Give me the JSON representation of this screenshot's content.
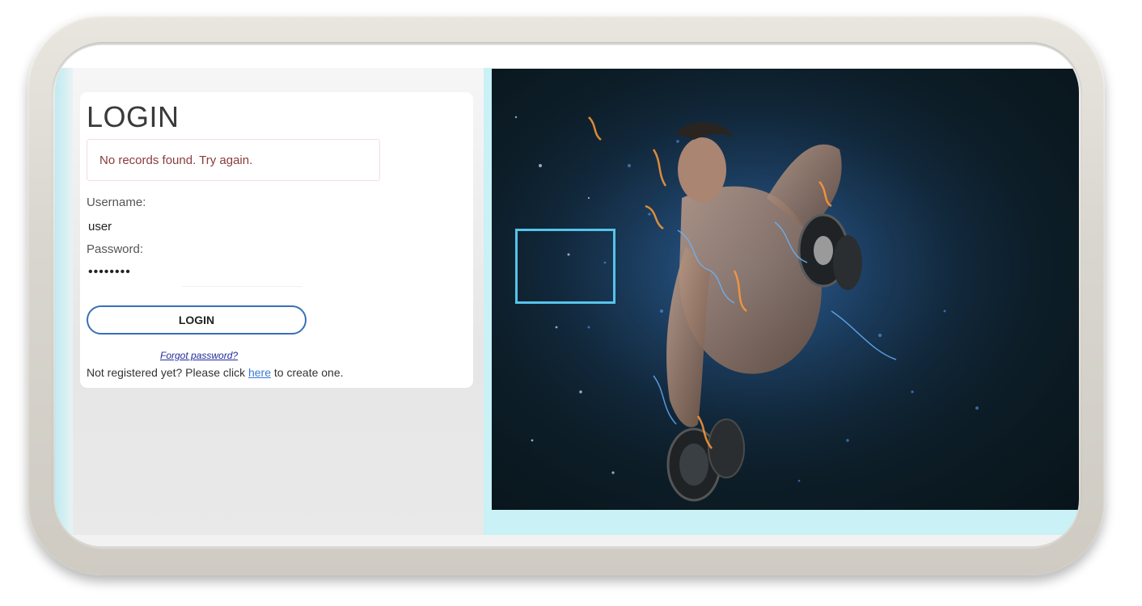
{
  "login": {
    "title": "LOGIN",
    "alert": "No records found. Try again.",
    "username_label": "Username:",
    "username_value": "user",
    "password_label": "Password:",
    "password_value": "••••••••",
    "submit_label": "LOGIN",
    "forgot_link": "Forgot password?",
    "register_prefix": "Not registered yet? Please click",
    "register_link": "here",
    "register_suffix": "to create one."
  },
  "colors": {
    "accent_blue": "#3a6fb8",
    "alert_text": "#8a3b3b",
    "selection_box": "#56c3ea",
    "page_cyan": "#c9f1f6"
  }
}
